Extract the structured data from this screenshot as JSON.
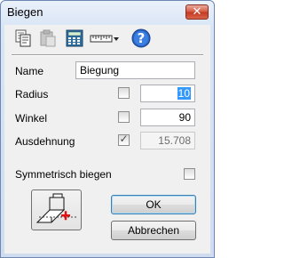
{
  "window": {
    "title": "Biegen",
    "close_glyph": "✕"
  },
  "toolbar": {
    "icons": [
      "copy-icon",
      "paste-icon",
      "calculator-icon",
      "ruler-dropdown-icon",
      "help-icon"
    ],
    "help_glyph": "?"
  },
  "form": {
    "name_label": "Name",
    "name_value": "Biegung",
    "radius_label": "Radius",
    "radius_value": "10",
    "radius_checked": false,
    "winkel_label": "Winkel",
    "winkel_value": "90",
    "winkel_checked": false,
    "ausdehnung_label": "Ausdehnung",
    "ausdehnung_value": "15.708",
    "ausdehnung_checked": true,
    "check_glyph": "✓",
    "symmetrisch_label": "Symmetrisch biegen",
    "symmetrisch_checked": false
  },
  "buttons": {
    "ok_label": "OK",
    "cancel_label": "Abbrechen"
  },
  "colors": {
    "selection": "#3399ff",
    "dialog_bg": "#f0f0f0",
    "title_gradient_top": "#eaf1fb"
  }
}
